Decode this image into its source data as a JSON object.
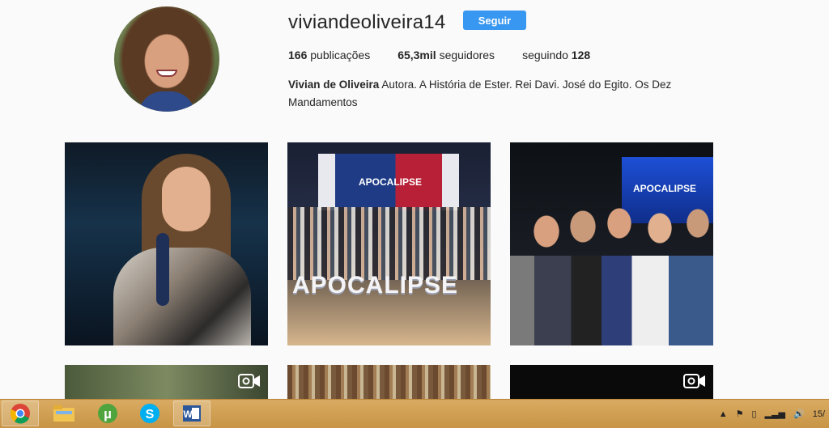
{
  "profile": {
    "username": "viviandeoliveira14",
    "follow_label": "Seguir",
    "posts_count": "166",
    "posts_label": "publicações",
    "followers_count": "65,3mil",
    "followers_label": "seguidores",
    "following_label": "seguindo",
    "following_count": "128",
    "bio_name": "Vivian de Oliveira",
    "bio_text": "Autora. A História de Ester. Rei Davi. José do Egito. Os Dez Mandamentos"
  },
  "posts": {
    "post2_banner_text": "APOCALIPSE",
    "post2_letters": "APOCALIPSE",
    "post3_screen_text": "APOCALIPSE"
  },
  "taskbar": {
    "apps": [
      "chrome-icon",
      "file-explorer-icon",
      "utorrent-icon",
      "skype-icon",
      "word-icon"
    ],
    "clock": "15/"
  },
  "colors": {
    "follow_button": "#3897f0",
    "taskbar": "#d0a056"
  }
}
